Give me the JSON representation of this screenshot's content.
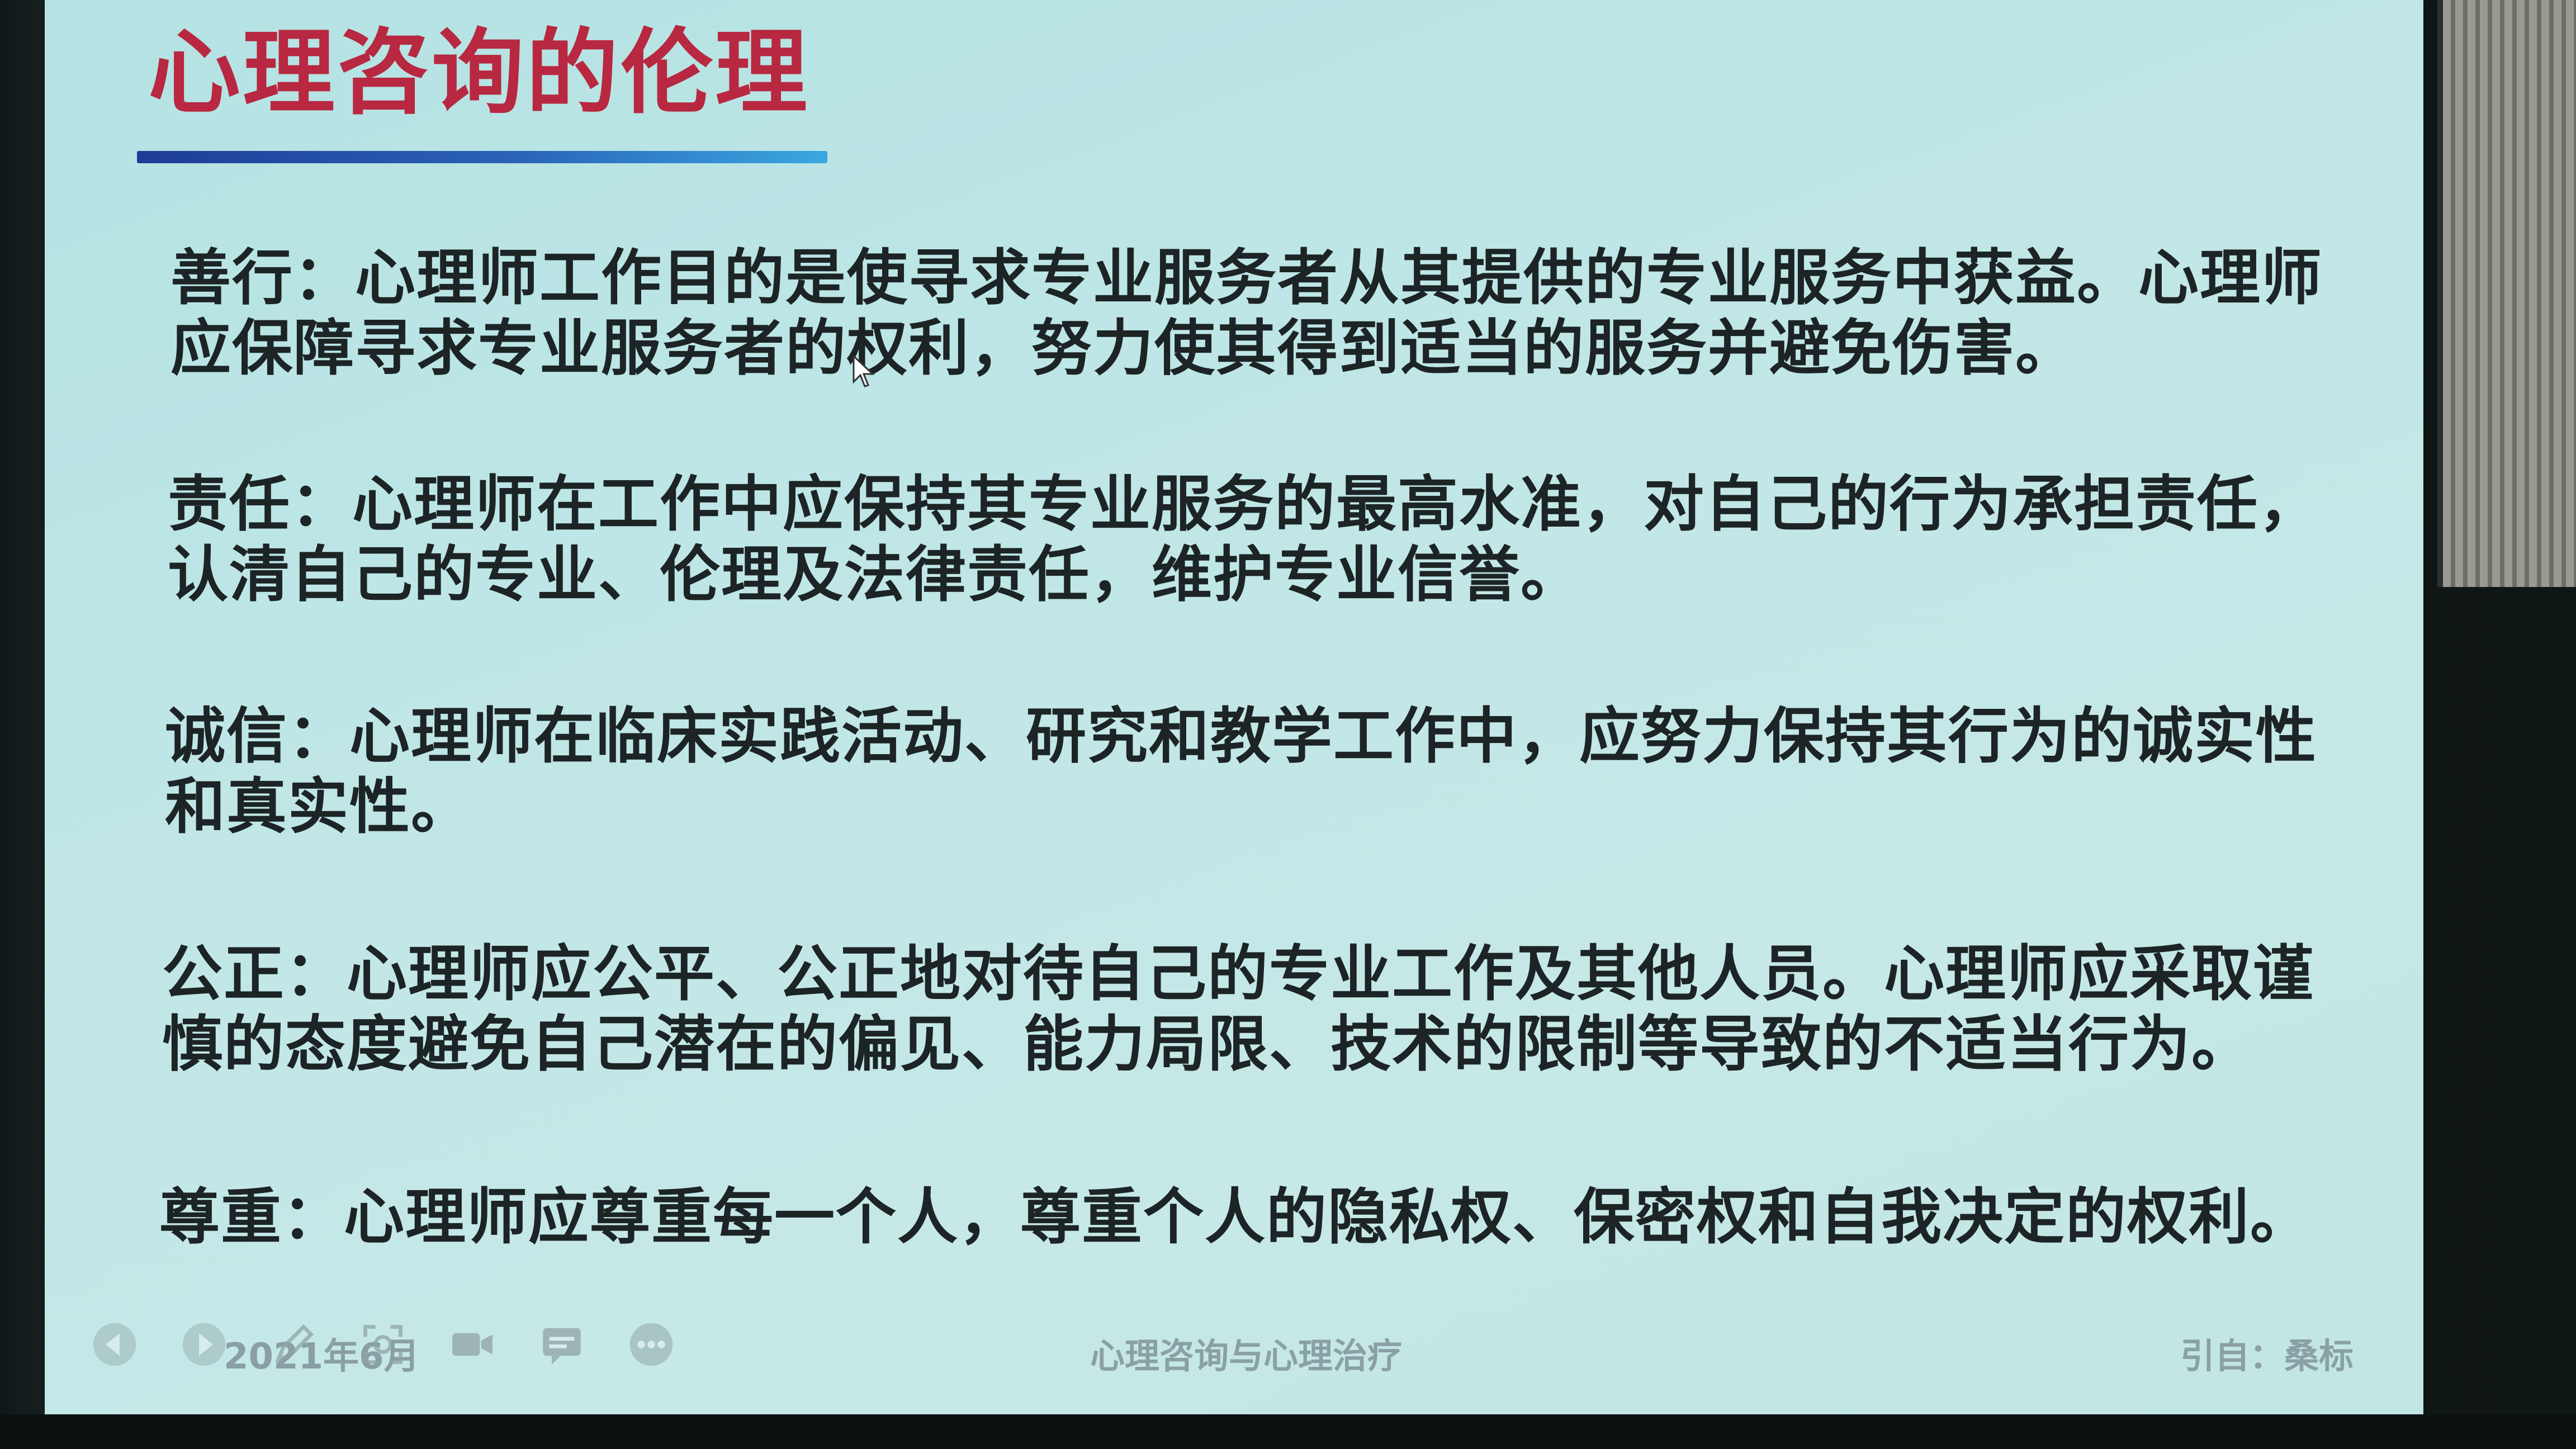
{
  "slide": {
    "title": "心理咨询的伦理",
    "paragraphs": [
      "善行：心理师工作目的是使寻求专业服务者从其提供的专业服务中获益。心理师应保障寻求专业服务者的权利，努力使其得到适当的服务并避免伤害。",
      "责任：心理师在工作中应保持其专业服务的最高水准，对自己的行为承担责任，认清自己的专业、伦理及法律责任，维护专业信誉。",
      "诚信：心理师在临床实践活动、研究和教学工作中，应努力保持其行为的诚实性和真实性。",
      "公正：心理师应公平、公正地对待自己的专业工作及其他人员。心理师应采取谨慎的态度避免自己潜在的偏见、能力局限、技术的限制等导致的不适当行为。",
      "尊重：心理师应尊重每一个人，尊重个人的隐私权、保密权和自我决定的权利。"
    ],
    "footer": {
      "date": "2021年6月",
      "center": "心理咨询与心理治疗",
      "right": "引自：桑标"
    }
  },
  "controls": [
    {
      "icon": "previous-icon"
    },
    {
      "icon": "next-icon"
    },
    {
      "icon": "pen-icon"
    },
    {
      "icon": "zoom-icon"
    },
    {
      "icon": "camera-icon"
    },
    {
      "icon": "subtitle-icon"
    },
    {
      "icon": "more-icon"
    }
  ],
  "colors": {
    "title": "#b82840",
    "body_text": "#1d2425",
    "slide_background": "#bfe6e6",
    "rule_start": "#1f3c96",
    "rule_end": "#3aa7e0"
  }
}
